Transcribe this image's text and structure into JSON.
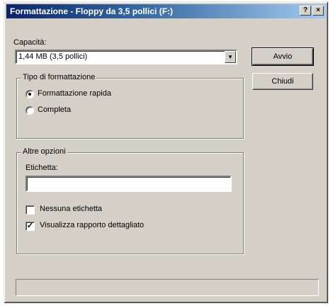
{
  "window": {
    "title": "Formattazione - Floppy da 3,5 pollici (F:)",
    "help_button": "?",
    "close_button": "×"
  },
  "capacity": {
    "label": "Capacità:",
    "value": "1,44 MB (3,5 pollici)",
    "dropdown_icon": "▼"
  },
  "buttons": {
    "start": "Avvio",
    "close": "Chiudi"
  },
  "format_type": {
    "legend": "Tipo di formattazione",
    "options": [
      {
        "label": "Formattazione rapida",
        "selected": true
      },
      {
        "label": "Completa",
        "selected": false
      }
    ]
  },
  "other_options": {
    "legend": "Altre opzioni",
    "label_field": {
      "label": "Etichetta:",
      "value": ""
    },
    "checkboxes": [
      {
        "label": "Nessuna etichetta",
        "checked": false
      },
      {
        "label": "Visualizza rapporto dettagliato",
        "checked": true
      }
    ],
    "check_mark": "✓"
  },
  "status_text": ""
}
